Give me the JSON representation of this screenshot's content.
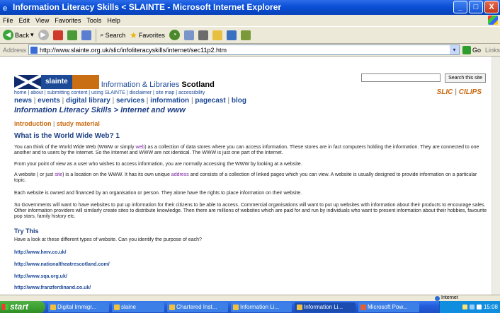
{
  "window": {
    "title": "Information Literacy Skills < SLAINTE - Microsoft Internet Explorer",
    "min": "_",
    "max": "□",
    "close": "X"
  },
  "menu": [
    "File",
    "Edit",
    "View",
    "Favorites",
    "Tools",
    "Help"
  ],
  "toolbar": {
    "back": "Back",
    "search": "Search",
    "favorites": "Favorites"
  },
  "address": {
    "label": "Address",
    "url": "http://www.slainte.org.uk/slic/infoliteracyskills/internet/sec11p2.htm",
    "go": "Go",
    "links": "Links"
  },
  "page": {
    "logo_text": "slainte",
    "org_name": "Information & Libraries ",
    "org_name_bold": "Scotland",
    "search_button": "Search this site",
    "slic": "SLIC",
    "cilips": "CILIPS",
    "top_links": [
      "home",
      "about",
      "submitting content",
      "using SLAINTE",
      "disclaimer",
      "site map",
      "accessibility"
    ],
    "main_nav": [
      "news",
      "events",
      "digital library",
      "services",
      "information",
      "pagecast",
      "blog"
    ],
    "heading": "Information Literacy Skills > Internet and www",
    "sub_nav": [
      "introduction",
      "study material"
    ],
    "title": "What is the World Wide Web? 1",
    "p1_a": "You can think of the World Wide Web (WWW or simply ",
    "p1_hl": "web",
    "p1_b": ") as a collection of data stores where you can access information. These stores are in fact computers holding the information. They are connected to one another and to users by the Internet. So the Internet and WWW are not identical. The WWW is just one part of the Internet.",
    "p2": "From your point of view as a user who wishes to access information, you are normally accessing the WWW by looking at a website.",
    "p3_a": "A website ( or just ",
    "p3_hl1": "site",
    "p3_b": ") is a location on the WWW. It has its own unique ",
    "p3_hl2": "address",
    "p3_c": " and consists of a collection of linked pages which you can view. A website is usually designed to provide information on a particular topic.",
    "p4": "Each website is owned and financed by an organisation or person. They alone have the rights to place information on their website.",
    "p5": "So Governments will want to have websites to put up information for their citizens to be able to access. Commercial organisations will want to put up websites with information about their products to encourage sales. Other information providers will similarly create sites to distribute knowledge. Then there are millions of websites which are paid for and run by individuals who want to present information about their hobbies, favourite pop stars, family history etc.",
    "try_title": "Try This",
    "try_text": "Have a look at these different types of website. Can you identify the purpose of each?",
    "links": [
      "http://www.hmv.co.uk/",
      "http://www.nationaltheatrescotland.com/",
      "http://www.sqa.org.uk/",
      "http://www.franzferdinand.co.uk/"
    ]
  },
  "status": {
    "zone": "Internet"
  },
  "taskbar": {
    "start": "start",
    "tasks": [
      "Digital Immigr...",
      "slaine",
      "Chartered Inst...",
      "Information Li...",
      "Information Li...",
      "Microsoft Pow..."
    ],
    "clock": "15:08"
  }
}
